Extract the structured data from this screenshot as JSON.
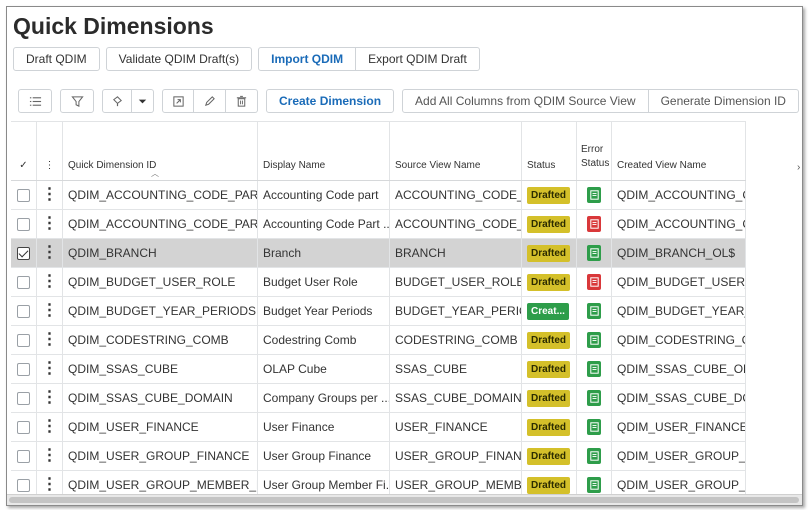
{
  "page": {
    "title": "Quick Dimensions"
  },
  "tabs": {
    "draft": "Draft QDIM",
    "validate": "Validate QDIM Draft(s)",
    "import": "Import QDIM",
    "export": "Export QDIM Draft"
  },
  "toolbar": {
    "create": "Create Dimension",
    "add_all": "Add All Columns from QDIM Source View",
    "generate": "Generate Dimension ID"
  },
  "columns": {
    "select": "✓",
    "menu": "⋮",
    "id": "Quick Dimension ID",
    "display": "Display Name",
    "source": "Source View Name",
    "status": "Status",
    "error_line1": "Error",
    "error_line2": "Status",
    "created": "Created View Name"
  },
  "rows": [
    {
      "id": "QDIM_ACCOUNTING_CODE_PARTS",
      "display": "Accounting Code part",
      "source": "ACCOUNTING_CODE_P...",
      "status": "Drafted",
      "status_kind": "drafted",
      "error": "green",
      "created": "QDIM_ACCOUNTING_C...",
      "selected": false
    },
    {
      "id": "QDIM_ACCOUNTING_CODE_PART_...",
      "display": "Accounting Code Part ...",
      "source": "ACCOUNTING_CODE_P...",
      "status": "Drafted",
      "status_kind": "drafted",
      "error": "red",
      "created": "QDIM_ACCOUNTING_C...",
      "selected": false
    },
    {
      "id": "QDIM_BRANCH",
      "display": "Branch",
      "source": "BRANCH",
      "status": "Drafted",
      "status_kind": "drafted",
      "error": "green",
      "created": "QDIM_BRANCH_OL$",
      "selected": true
    },
    {
      "id": "QDIM_BUDGET_USER_ROLE",
      "display": "Budget User Role",
      "source": "BUDGET_USER_ROLE",
      "status": "Drafted",
      "status_kind": "drafted",
      "error": "red",
      "created": "QDIM_BUDGET_USER_...",
      "selected": false
    },
    {
      "id": "QDIM_BUDGET_YEAR_PERIODS",
      "display": "Budget Year Periods",
      "source": "BUDGET_YEAR_PERIODS",
      "status": "Creat...",
      "status_kind": "created",
      "error": "green",
      "created": "QDIM_BUDGET_YEAR_...",
      "selected": false
    },
    {
      "id": "QDIM_CODESTRING_COMB",
      "display": "Codestring Comb",
      "source": "CODESTRING_COMB",
      "status": "Drafted",
      "status_kind": "drafted",
      "error": "green",
      "created": "QDIM_CODESTRING_C...",
      "selected": false
    },
    {
      "id": "QDIM_SSAS_CUBE",
      "display": "OLAP Cube",
      "source": "SSAS_CUBE",
      "status": "Drafted",
      "status_kind": "drafted",
      "error": "green",
      "created": "QDIM_SSAS_CUBE_OL$",
      "selected": false
    },
    {
      "id": "QDIM_SSAS_CUBE_DOMAIN",
      "display": "Company Groups per ...",
      "source": "SSAS_CUBE_DOMAIN",
      "status": "Drafted",
      "status_kind": "drafted",
      "error": "green",
      "created": "QDIM_SSAS_CUBE_DO...",
      "selected": false
    },
    {
      "id": "QDIM_USER_FINANCE",
      "display": "User Finance",
      "source": "USER_FINANCE",
      "status": "Drafted",
      "status_kind": "drafted",
      "error": "green",
      "created": "QDIM_USER_FINANCE_...",
      "selected": false
    },
    {
      "id": "QDIM_USER_GROUP_FINANCE",
      "display": "User Group Finance",
      "source": "USER_GROUP_FINANCE",
      "status": "Drafted",
      "status_kind": "drafted",
      "error": "green",
      "created": "QDIM_USER_GROUP_F...",
      "selected": false
    },
    {
      "id": "QDIM_USER_GROUP_MEMBER_FIN...",
      "display": "User Group Member Fi...",
      "source": "USER_GROUP_MEMBE...",
      "status": "Drafted",
      "status_kind": "drafted",
      "error": "green",
      "created": "QDIM_USER_GROUP_...",
      "selected": false
    }
  ],
  "colors": {
    "accent": "#1a6bb8",
    "drafted": "#d4c02a",
    "created": "#2e9d4a",
    "error_ok": "#2e9d4a",
    "error_bad": "#d9383a",
    "selected_row": "#d3d3d3"
  },
  "icons": [
    "list-icon",
    "filter-icon",
    "paint-icon",
    "chevron-down-icon",
    "edit-window-icon",
    "pencil-icon",
    "trash-icon",
    "document-icon",
    "sort-up-icon"
  ]
}
